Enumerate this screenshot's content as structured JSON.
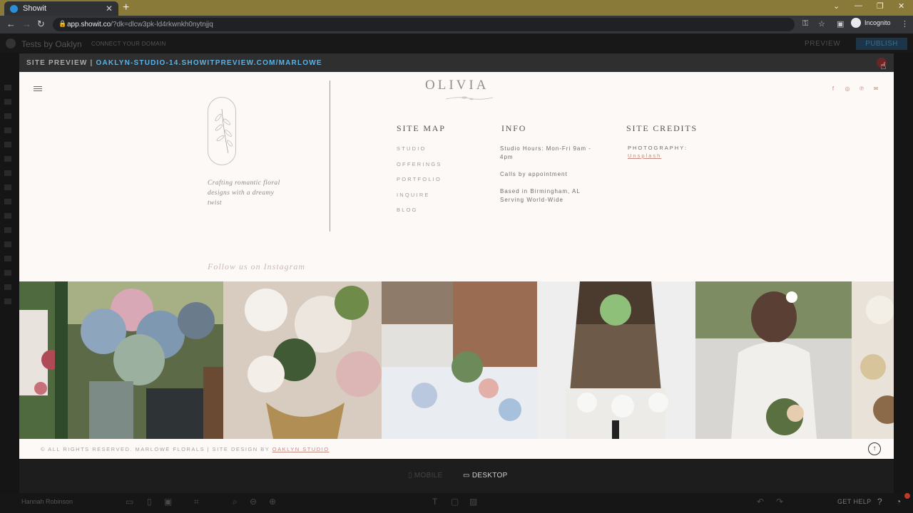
{
  "browser": {
    "tab_title": "Showit",
    "tab_close": "✕",
    "new_tab": "+",
    "url_host": "app.showit.co",
    "url_path": "/?dk=dlcw3pk-ld4rkwnkh0nytnjjq",
    "profile_label": "Incognito",
    "window_controls": [
      "⌄",
      "—",
      "❐",
      "✕"
    ]
  },
  "app": {
    "project_name": "Tests by Oaklyn",
    "connect_domain": "CONNECT YOUR DOMAIN",
    "preview_label": "PREVIEW",
    "publish_label": "PUBLISH",
    "user_name": "Hannah Robinson",
    "get_help": "GET HELP"
  },
  "preview_modal": {
    "label_prefix": "SITE PREVIEW | ",
    "preview_url": "OAKLYN-STUDIO-14.SHOWITPREVIEW.COM/MARLOWE"
  },
  "site": {
    "brand": "OLIVIA",
    "tagline": "Crafting romantic floral designs with a dreamy twist",
    "sitemap": {
      "title": "SITE MAP",
      "items": [
        "STUDIO",
        "OFFERINGS",
        "PORTFOLIO",
        "INQUIRE",
        "BLOG"
      ]
    },
    "info": {
      "title": "INFO",
      "hours": "Studio Hours: Mon-Fri 9am - 4pm",
      "calls": "Calls by appointment",
      "location": "Based in Birmingham, AL Serving World-Wide"
    },
    "credits": {
      "title": "SITE CREDITS",
      "photography_label": "PHOTOGRAPHY:",
      "photography_link": "Unsplash"
    },
    "follow_label": "Follow us on Instagram",
    "footer": {
      "copyright": "© ALL RIGHTS RESERVED.  MARLOWE FLORALS |  SITE DESIGN BY ",
      "designer": "OAKLYN STUDIO"
    },
    "socials": [
      "f",
      "◎",
      "℗",
      "✉"
    ]
  },
  "device_switch": {
    "mobile": "MOBILE",
    "desktop": "DESKTOP",
    "active": "desktop"
  },
  "colors": {
    "accent_link": "#5ab3e6",
    "rose": "#c58a80",
    "site_bg": "#fdf9f7"
  }
}
